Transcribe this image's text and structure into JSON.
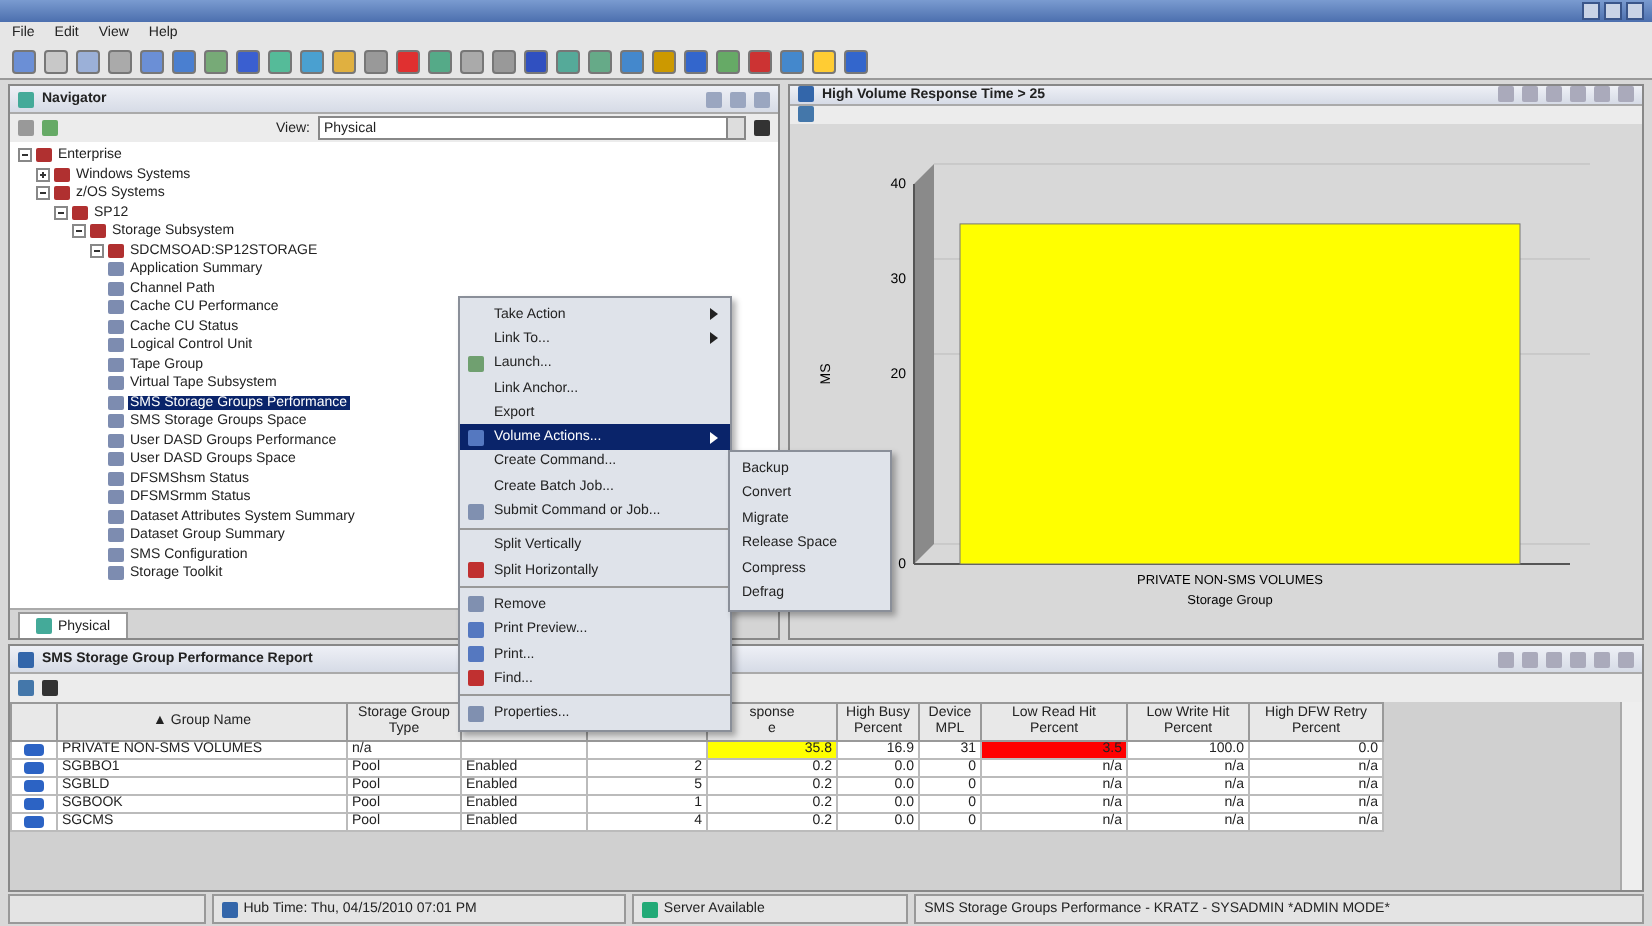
{
  "menu_bar": [
    "File",
    "Edit",
    "View",
    "Help"
  ],
  "navigator": {
    "title": "Navigator",
    "view_label": "View:",
    "view_value": "Physical",
    "tree": [
      {
        "label": "Enterprise",
        "expanded": true,
        "children": [
          {
            "label": "Windows Systems",
            "expanded": false
          },
          {
            "label": "z/OS Systems",
            "expanded": true,
            "children": [
              {
                "label": "SP12",
                "expanded": true,
                "children": [
                  {
                    "label": "Storage Subsystem",
                    "expanded": true,
                    "children": [
                      {
                        "label": "SDCMSOAD:SP12STORAGE",
                        "expanded": true,
                        "children": [
                          {
                            "label": "Application Summary",
                            "selected": false
                          },
                          {
                            "label": "Channel Path",
                            "selected": false
                          },
                          {
                            "label": "Cache CU Performance",
                            "selected": false
                          },
                          {
                            "label": "Cache CU Status",
                            "selected": false
                          },
                          {
                            "label": "Logical Control Unit",
                            "selected": false
                          },
                          {
                            "label": "Tape Group",
                            "selected": false
                          },
                          {
                            "label": "Virtual Tape Subsystem",
                            "selected": false
                          },
                          {
                            "label": "SMS Storage Groups Performance",
                            "selected": true
                          },
                          {
                            "label": "SMS Storage Groups Space",
                            "selected": false
                          },
                          {
                            "label": "User DASD Groups Performance",
                            "selected": false
                          },
                          {
                            "label": "User DASD Groups Space",
                            "selected": false
                          },
                          {
                            "label": "DFSMShsm Status",
                            "selected": false
                          },
                          {
                            "label": "DFSMSrmm Status",
                            "selected": false
                          },
                          {
                            "label": "Dataset Attributes System Summary",
                            "selected": false
                          },
                          {
                            "label": "Dataset Group Summary",
                            "selected": false
                          },
                          {
                            "label": "SMS Configuration",
                            "selected": false
                          },
                          {
                            "label": "Storage Toolkit",
                            "selected": false
                          }
                        ]
                      }
                    ]
                  }
                ]
              }
            ]
          }
        ]
      }
    ],
    "tab": "Physical"
  },
  "chart_panel": {
    "title": "High Volume Response Time > 25",
    "chart_data": {
      "type": "bar",
      "xlabel": "Storage Group",
      "ylabel": "MS",
      "categories": [
        "PRIVATE NON-SMS VOLUMES"
      ],
      "series": [
        {
          "color": "#ffff00",
          "values": [
            35.8
          ]
        }
      ],
      "ylim": [
        0,
        40
      ],
      "yticks": [
        0,
        20,
        30,
        40
      ]
    }
  },
  "report": {
    "title": "SMS Storage Group Performance Report",
    "columns": [
      {
        "label": "Group Name",
        "sort_indicator": "▲"
      },
      {
        "label": "Storage Group\nType"
      },
      {},
      {},
      {
        "label": "sponse\ne"
      },
      {
        "label": "High Busy\nPercent"
      },
      {
        "label": "Device\nMPL"
      },
      {
        "label": "Low Read Hit\nPercent"
      },
      {
        "label": "Low Write Hit\nPercent"
      },
      {
        "label": "High DFW Retry\nPercent"
      }
    ],
    "rows": [
      {
        "cells": [
          "PRIVATE NON-SMS VOLUMES",
          "n/a",
          null,
          null,
          {
            "text": "35.8",
            "color": "#ffff00"
          },
          "16.9",
          "31",
          {
            "text": "3.5",
            "color": "#ff0000"
          },
          "100.0",
          "0.0"
        ]
      },
      {
        "cells": [
          "SGBBO1",
          "Pool",
          "Enabled",
          "2",
          "0.2",
          "0.0",
          "0",
          "n/a",
          "n/a",
          "n/a"
        ]
      },
      {
        "cells": [
          "SGBLD",
          "Pool",
          "Enabled",
          "5",
          "0.2",
          "0.0",
          "0",
          "n/a",
          "n/a",
          "n/a"
        ]
      },
      {
        "cells": [
          "SGBOOK",
          "Pool",
          "Enabled",
          "1",
          "0.2",
          "0.0",
          "0",
          "n/a",
          "n/a",
          "n/a"
        ]
      },
      {
        "cells": [
          "SGCMS",
          "Pool",
          "Enabled",
          "4",
          "0.2",
          "0.0",
          "0",
          "n/a",
          "n/a",
          "n/a"
        ]
      }
    ]
  },
  "context_menu": {
    "items": [
      {
        "kind": "item",
        "label": "Take Action",
        "submenu": true,
        "selected": false
      },
      {
        "kind": "item",
        "label": "Link To...",
        "submenu": true,
        "selected": false
      },
      {
        "kind": "item",
        "label": "Launch...",
        "submenu": false,
        "selected": false
      },
      {
        "kind": "item",
        "label": "Link Anchor...",
        "submenu": false,
        "selected": false
      },
      {
        "kind": "item",
        "label": "Export",
        "submenu": false,
        "selected": false
      },
      {
        "kind": "item",
        "label": "Volume Actions...",
        "submenu": true,
        "selected": true
      },
      {
        "kind": "item",
        "label": "Create Command...",
        "submenu": false,
        "selected": false
      },
      {
        "kind": "item",
        "label": "Create Batch Job...",
        "submenu": false,
        "selected": false
      },
      {
        "kind": "item",
        "label": "Submit Command or Job...",
        "submenu": false,
        "selected": false
      },
      {
        "kind": "separator"
      },
      {
        "kind": "item",
        "label": "Split Vertically",
        "submenu": false,
        "selected": false
      },
      {
        "kind": "item",
        "label": "Split Horizontally",
        "submenu": false,
        "selected": false
      },
      {
        "kind": "separator"
      },
      {
        "kind": "item",
        "label": "Remove",
        "submenu": false,
        "selected": false
      },
      {
        "kind": "item",
        "label": "Print Preview...",
        "submenu": false,
        "selected": false
      },
      {
        "kind": "item",
        "label": "Print...",
        "submenu": false,
        "selected": false
      },
      {
        "kind": "item",
        "label": "Find...",
        "submenu": false,
        "selected": false
      },
      {
        "kind": "separator"
      },
      {
        "kind": "item",
        "label": "Properties...",
        "submenu": false,
        "selected": false
      }
    ],
    "submenu": [
      "Backup",
      "Convert",
      "Migrate",
      "Release Space",
      "Compress",
      "Defrag"
    ]
  },
  "status_bar": {
    "hub_time": "Hub Time: Thu, 04/15/2010 07:01 PM",
    "server": "Server Available",
    "workspace": "SMS Storage Groups Performance - KRATZ - SYSADMIN  *ADMIN MODE*"
  }
}
